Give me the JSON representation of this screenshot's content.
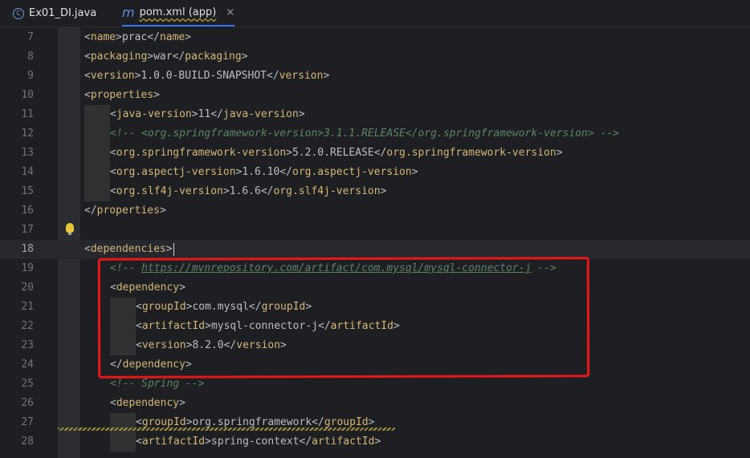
{
  "tabs": [
    {
      "label": "Ex01_DI.java",
      "icon": "class-icon"
    },
    {
      "label": "pom.xml (app)",
      "icon": "maven-icon"
    }
  ],
  "tab_close_symbol": "×",
  "lines": [
    {
      "num": "7",
      "tag": "name",
      "value": "prac"
    },
    {
      "num": "8",
      "tag": "packaging",
      "value": "war"
    },
    {
      "num": "9",
      "tag": "version",
      "value": "1.0.0-BUILD-SNAPSHOT"
    },
    {
      "num": "10",
      "open": "properties"
    },
    {
      "num": "11",
      "tag": "java-version",
      "value": "11"
    },
    {
      "num": "12",
      "comment": "<!-- <org.springframework-version>3.1.1.RELEASE</org.springframework-version> -->"
    },
    {
      "num": "13",
      "tag": "org.springframework-version",
      "value": "5.2.0.RELEASE"
    },
    {
      "num": "14",
      "tag": "org.aspectj-version",
      "value": "1.6.10"
    },
    {
      "num": "15",
      "tag": "org.slf4j-version",
      "value": "1.6.6"
    },
    {
      "num": "16",
      "close": "properties"
    },
    {
      "num": "17"
    },
    {
      "num": "18",
      "open": "dependencies"
    },
    {
      "num": "19",
      "comment_open": "<!-- ",
      "link": "https://mvnrepository.com/artifact/com.mysql/mysql-connector-j",
      "comment_close": " -->"
    },
    {
      "num": "20",
      "open": "dependency"
    },
    {
      "num": "21",
      "tag": "groupId",
      "value": "com.mysql"
    },
    {
      "num": "22",
      "tag": "artifactId",
      "value": "mysql-connector-j"
    },
    {
      "num": "23",
      "tag": "version",
      "value": "8.2.0"
    },
    {
      "num": "24",
      "close": "dependency"
    },
    {
      "num": "25",
      "comment": "<!-- Spring -->"
    },
    {
      "num": "26",
      "open": "dependency"
    },
    {
      "num": "27",
      "tag": "groupId",
      "value": "org.springframework"
    },
    {
      "num": "28",
      "tag": "artifactId",
      "value": "spring-context"
    }
  ],
  "current_line": "18",
  "colors": {
    "tag": "#d5b778",
    "text": "#bcbec4",
    "comment": "#5f826b",
    "highlight_box": "#e81818",
    "tab_underline": "#3574f0"
  }
}
